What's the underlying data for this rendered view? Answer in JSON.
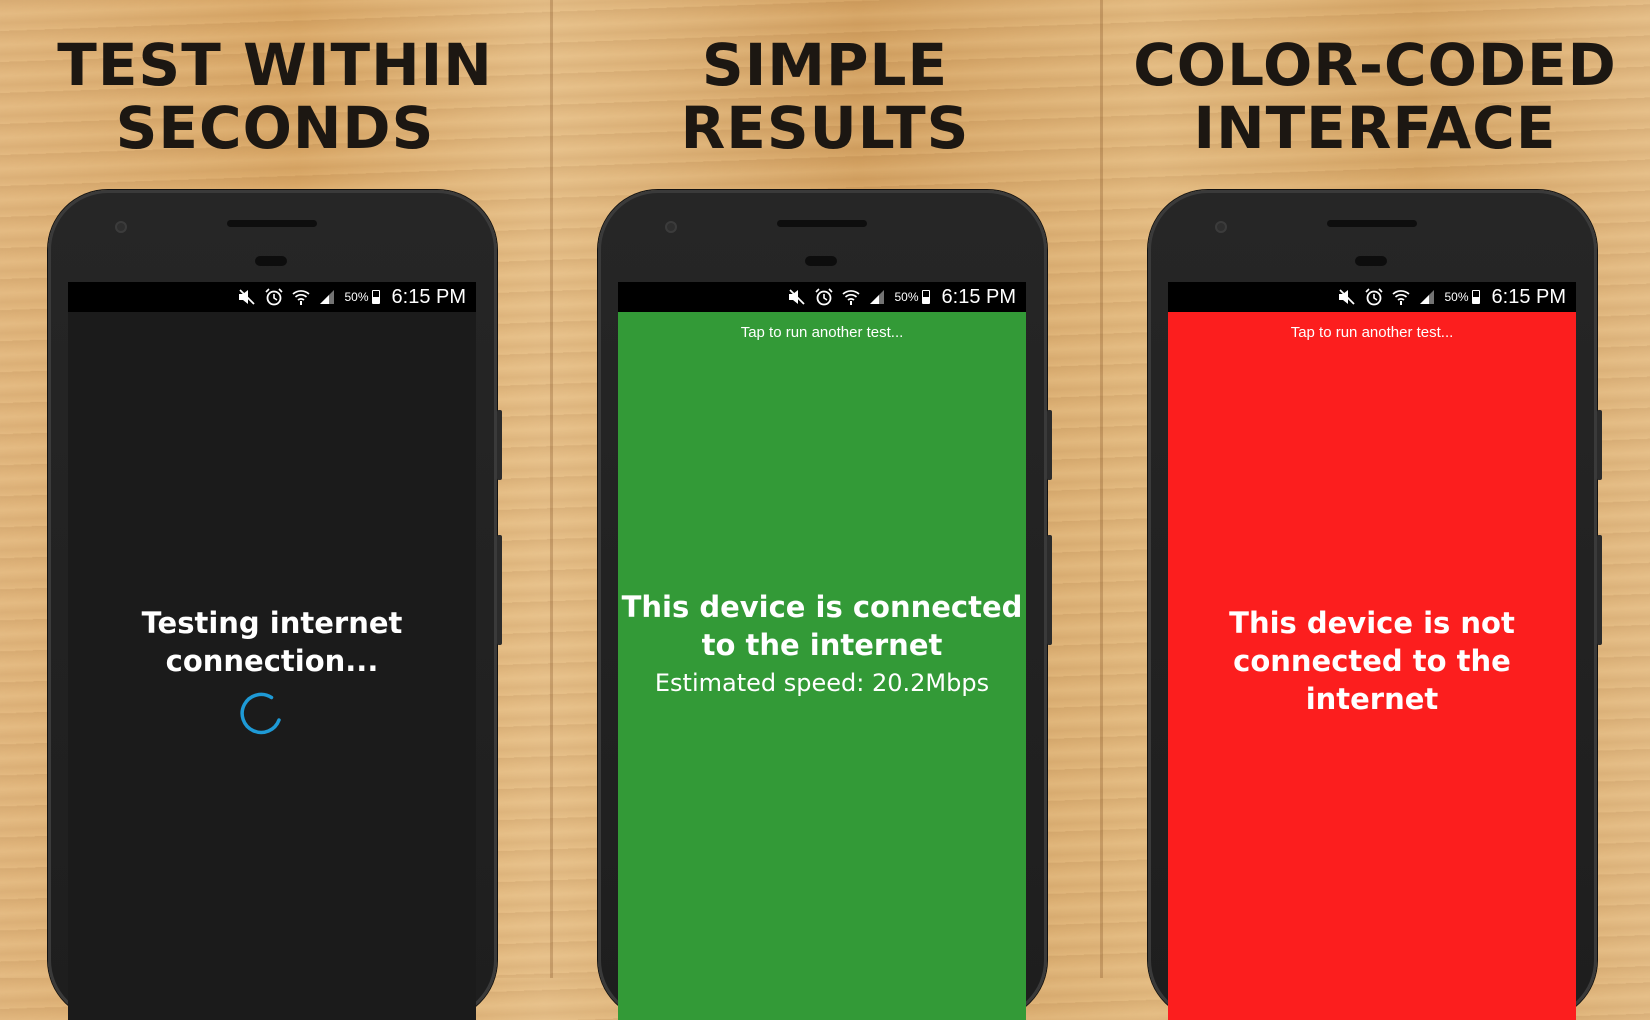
{
  "panels": [
    {
      "title_line1": "TEST WITHIN",
      "title_line2": "SECONDS",
      "status": {
        "battery": "50%",
        "time": "6:15 PM"
      },
      "screen_color": "#1b1b1b",
      "message_line1": "Testing internet",
      "message_line2": "connection..."
    },
    {
      "title_line1": "SIMPLE",
      "title_line2": "RESULTS",
      "status": {
        "battery": "50%",
        "time": "6:15 PM"
      },
      "screen_color": "#339a37",
      "tap_hint": "Tap to run another test...",
      "message_line1": "This device is connected",
      "message_line2": "to the internet",
      "speed": "Estimated speed: 20.2Mbps"
    },
    {
      "title_line1": "COLOR-CODED",
      "title_line2": "INTERFACE",
      "status": {
        "battery": "50%",
        "time": "6:15 PM"
      },
      "screen_color": "#fc1e1e",
      "tap_hint": "Tap to run another test...",
      "message_line1": "This device is not",
      "message_line2": "connected to the internet"
    }
  ],
  "spinner_color": "#1e9ad6",
  "icons": [
    "mute-icon",
    "alarm-icon",
    "wifi-icon",
    "signal-icon",
    "battery-icon"
  ]
}
